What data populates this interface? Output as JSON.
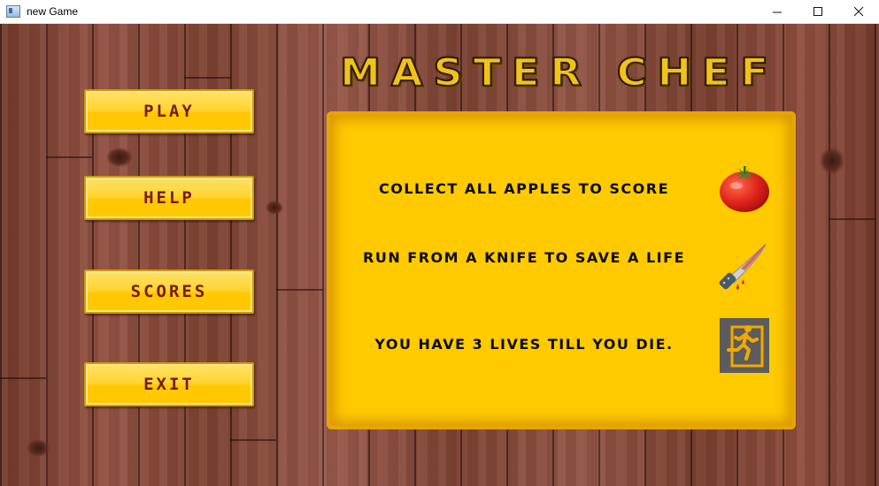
{
  "window": {
    "title": "new Game",
    "controls": {
      "minimize": "—",
      "maximize": "☐",
      "close": "✕"
    }
  },
  "game": {
    "title": "MASTER CHEF",
    "menu": [
      {
        "id": "play",
        "label": "PLAY"
      },
      {
        "id": "help",
        "label": "HELP"
      },
      {
        "id": "scores",
        "label": "SCORES"
      },
      {
        "id": "exit",
        "label": "EXIT"
      }
    ],
    "help_panel": {
      "lines": [
        {
          "text": "COLLECT ALL APPLES TO SCORE",
          "icon": "tomato-icon"
        },
        {
          "text": "RUN FROM A KNIFE TO SAVE A LIFE",
          "icon": "bloody-knife-icon"
        },
        {
          "text": "YOU HAVE 3 LIVES TILL YOU DIE.",
          "icon": "running-exit-icon"
        }
      ]
    },
    "colors": {
      "button_fill": "#ffc800",
      "button_text": "#7a1b14",
      "panel_fill": "#ffca00",
      "title_fill": "#f2c21a",
      "wood": "#8a4a37"
    }
  }
}
